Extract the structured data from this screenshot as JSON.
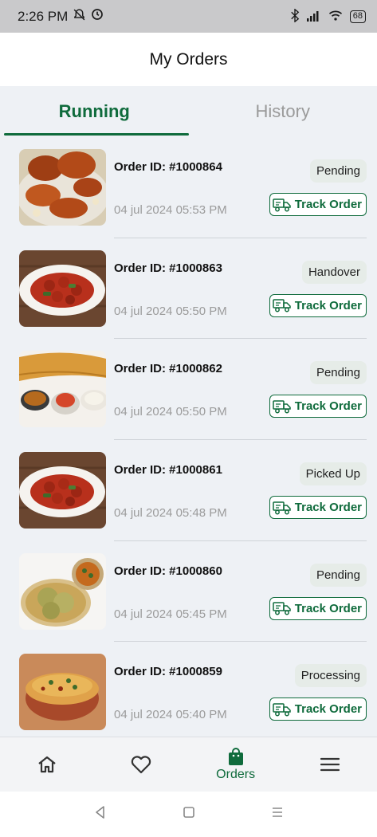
{
  "status_bar": {
    "time": "2:26 PM",
    "battery": "68"
  },
  "header": {
    "title": "My Orders"
  },
  "tabs": [
    {
      "label": "Running"
    },
    {
      "label": "History"
    }
  ],
  "orders": [
    {
      "id": "Order ID: #1000864",
      "date": "04 jul 2024 05:53 PM",
      "status": "Pending",
      "track": "Track Order",
      "image": "fried-chicken"
    },
    {
      "id": "Order ID: #1000863",
      "date": "04 jul 2024 05:50 PM",
      "status": "Handover",
      "track": "Track Order",
      "image": "chilli-chicken"
    },
    {
      "id": "Order ID: #1000862",
      "date": "04 jul 2024 05:50 PM",
      "status": "Pending",
      "track": "Track Order",
      "image": "dosa"
    },
    {
      "id": "Order ID: #1000861",
      "date": "04 jul 2024 05:48 PM",
      "status": "Picked Up",
      "track": "Track Order",
      "image": "chilli-chicken"
    },
    {
      "id": "Order ID: #1000860",
      "date": "04 jul 2024 05:45 PM",
      "status": "Pending",
      "track": "Track Order",
      "image": "puri-curry"
    },
    {
      "id": "Order ID: #1000859",
      "date": "04 jul 2024 05:40 PM",
      "status": "Processing",
      "track": "Track Order",
      "image": "biryani"
    }
  ],
  "bottom_nav": {
    "orders_label": "Orders"
  },
  "colors": {
    "accent": "#0f6b3c",
    "badge_bg": "#e6ece8",
    "page_bg": "#eef1f5"
  }
}
